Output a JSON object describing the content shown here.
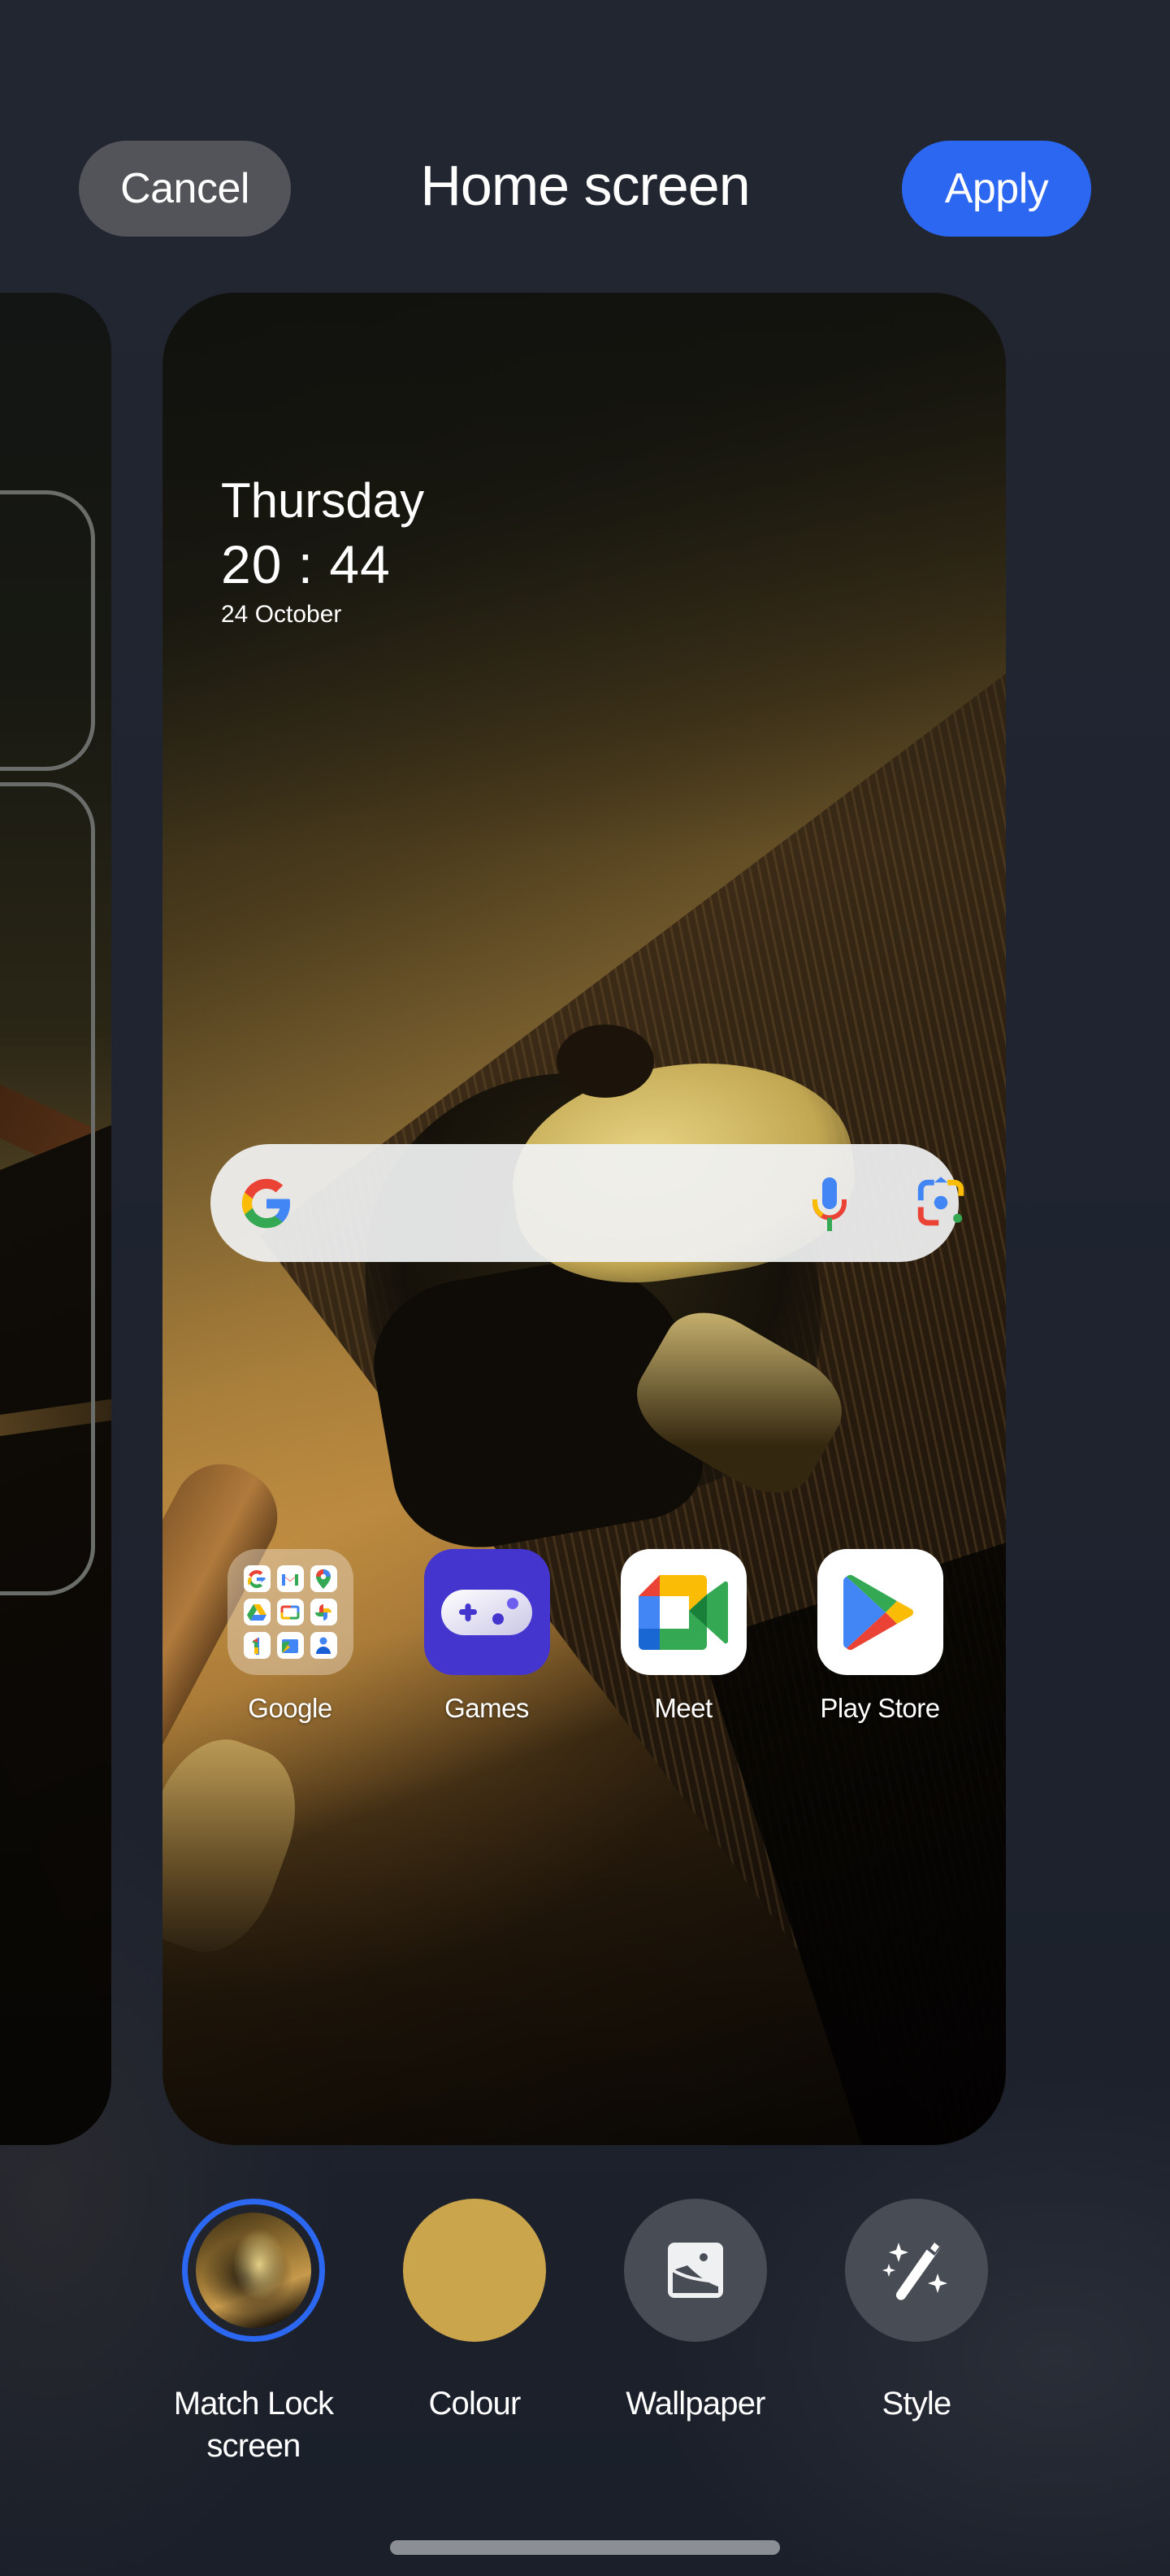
{
  "header": {
    "title": "Home screen",
    "cancel_label": "Cancel",
    "apply_label": "Apply"
  },
  "preview": {
    "clock": {
      "day": "Thursday",
      "time": "20 : 44",
      "date": "24 October"
    },
    "search_bar": {
      "left_icon": "google-g-icon",
      "right_icons": [
        "microphone-icon",
        "google-lens-icon"
      ]
    },
    "apps": [
      {
        "label": "Google",
        "icon": "folder-icon",
        "folder_contents": [
          "Google",
          "Gmail",
          "Maps",
          "Drive",
          "Play Movies",
          "Photos",
          "Google One",
          "Files",
          "Contacts"
        ]
      },
      {
        "label": "Games",
        "icon": "gamepad-icon"
      },
      {
        "label": "Meet",
        "icon": "google-meet-icon"
      },
      {
        "label": "Play Store",
        "icon": "play-store-icon"
      }
    ]
  },
  "options": [
    {
      "label": "Match Lock screen",
      "line1": "Match Lock",
      "line2": "screen",
      "icon": "wallpaper-thumbnail",
      "selected": true
    },
    {
      "label": "Colour",
      "icon": "colour-swatch",
      "swatch": "#caa54b",
      "selected": false
    },
    {
      "label": "Wallpaper",
      "icon": "wallpaper-icon",
      "selected": false
    },
    {
      "label": "Style",
      "icon": "magic-wand-icon",
      "selected": false
    }
  ],
  "colors": {
    "accent": "#2c67f2",
    "cancel_bg": "#525459",
    "background": "#1f2430",
    "colour_swatch": "#caa54b",
    "games_icon_bg": "#4435cf"
  }
}
